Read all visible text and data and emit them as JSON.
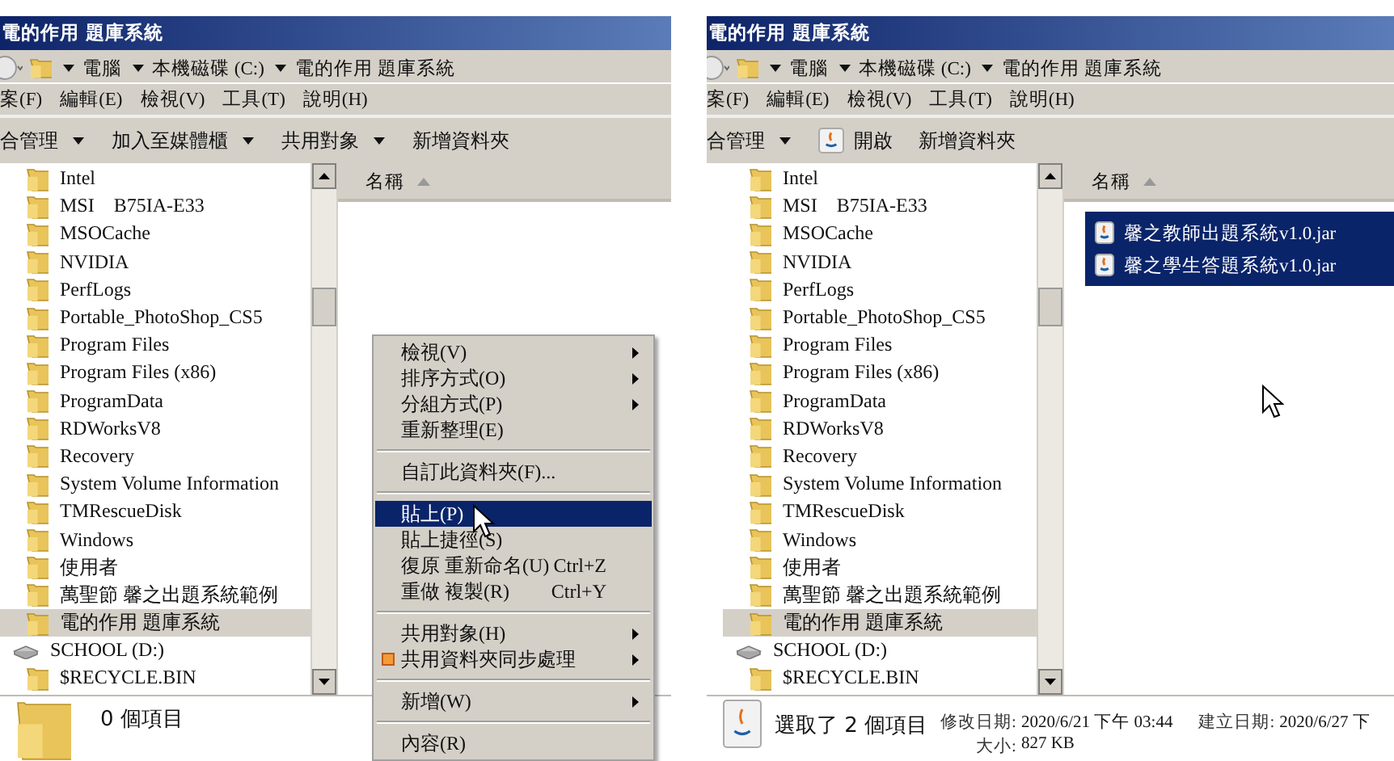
{
  "panels": [
    {
      "title": "電的作用 題庫系統",
      "breadcrumb": [
        "電腦",
        "本機磁碟 (C:)",
        "電的作用 題庫系統"
      ],
      "menu": [
        "案(F)",
        "編輯(E)",
        "檢視(V)",
        "工具(T)",
        "說明(H)"
      ],
      "toolbar": [
        {
          "kind": "dropdown",
          "label": "合管理"
        },
        {
          "kind": "dropdown",
          "label": "加入至媒體櫃"
        },
        {
          "kind": "dropdown",
          "label": "共用對象"
        },
        {
          "kind": "plain",
          "label": "新增資料夾"
        }
      ],
      "tree": [
        {
          "kind": "folder",
          "label": "Intel",
          "selected": false
        },
        {
          "kind": "folder",
          "label": "MSI　B75IA-E33",
          "selected": false
        },
        {
          "kind": "folder",
          "label": "MSOCache",
          "selected": false
        },
        {
          "kind": "folder",
          "label": "NVIDIA",
          "selected": false
        },
        {
          "kind": "folder",
          "label": "PerfLogs",
          "selected": false
        },
        {
          "kind": "folder",
          "label": "Portable_PhotoShop_CS5",
          "selected": false
        },
        {
          "kind": "folder",
          "label": "Program Files",
          "selected": false
        },
        {
          "kind": "folder",
          "label": "Program Files (x86)",
          "selected": false
        },
        {
          "kind": "folder",
          "label": "ProgramData",
          "selected": false
        },
        {
          "kind": "folder",
          "label": "RDWorksV8",
          "selected": false
        },
        {
          "kind": "folder",
          "label": "Recovery",
          "selected": false
        },
        {
          "kind": "folder",
          "label": "System Volume Information",
          "selected": false
        },
        {
          "kind": "folder",
          "label": "TMRescueDisk",
          "selected": false
        },
        {
          "kind": "folder",
          "label": "Windows",
          "selected": false
        },
        {
          "kind": "folder",
          "label": "使用者",
          "selected": false
        },
        {
          "kind": "folder",
          "label": "萬聖節 馨之出題系統範例",
          "selected": false
        },
        {
          "kind": "folder",
          "label": "電的作用 題庫系統",
          "selected": true
        },
        {
          "kind": "drive",
          "label": "SCHOOL (D:)",
          "selected": false
        },
        {
          "kind": "folder",
          "label": "$RECYCLE.BIN",
          "selected": false
        }
      ],
      "column_header": "名稱",
      "context_menu": [
        {
          "kind": "submenu",
          "label": "檢視(V)",
          "selected": false
        },
        {
          "kind": "submenu",
          "label": "排序方式(O)",
          "selected": false
        },
        {
          "kind": "submenu",
          "label": "分組方式(P)",
          "selected": false
        },
        {
          "kind": "item",
          "label": "重新整理(E)",
          "selected": false
        },
        {
          "kind": "separator"
        },
        {
          "kind": "item",
          "label": "自訂此資料夾(F)...",
          "selected": false
        },
        {
          "kind": "separator"
        },
        {
          "kind": "item",
          "label": "貼上(P)",
          "selected": true
        },
        {
          "kind": "item",
          "label": "貼上捷徑(S)",
          "selected": false
        },
        {
          "kind": "item",
          "label": "復原 重新命名(U)",
          "shortcut": "Ctrl+Z",
          "selected": false
        },
        {
          "kind": "item",
          "label": "重做 複製(R)",
          "shortcut": "Ctrl+Y",
          "selected": false
        },
        {
          "kind": "separator"
        },
        {
          "kind": "submenu",
          "label": "共用對象(H)",
          "selected": false
        },
        {
          "kind": "sync-submenu",
          "label": "共用資料夾同步處理",
          "selected": false
        },
        {
          "kind": "separator"
        },
        {
          "kind": "submenu",
          "label": "新增(W)",
          "selected": false
        },
        {
          "kind": "separator"
        },
        {
          "kind": "item",
          "label": "內容(R)",
          "selected": false
        }
      ],
      "status": {
        "kind": "folder",
        "summary": "0 個項目"
      }
    },
    {
      "title": "電的作用 題庫系統",
      "breadcrumb": [
        "電腦",
        "本機磁碟 (C:)",
        "電的作用 題庫系統"
      ],
      "menu": [
        "案(F)",
        "編輯(E)",
        "檢視(V)",
        "工具(T)",
        "說明(H)"
      ],
      "toolbar": [
        {
          "kind": "dropdown",
          "label": "合管理"
        },
        {
          "kind": "open",
          "label": "開啟"
        },
        {
          "kind": "plain",
          "label": "新增資料夾"
        }
      ],
      "tree": [
        {
          "kind": "folder",
          "label": "Intel",
          "selected": false
        },
        {
          "kind": "folder",
          "label": "MSI　B75IA-E33",
          "selected": false
        },
        {
          "kind": "folder",
          "label": "MSOCache",
          "selected": false
        },
        {
          "kind": "folder",
          "label": "NVIDIA",
          "selected": false
        },
        {
          "kind": "folder",
          "label": "PerfLogs",
          "selected": false
        },
        {
          "kind": "folder",
          "label": "Portable_PhotoShop_CS5",
          "selected": false
        },
        {
          "kind": "folder",
          "label": "Program Files",
          "selected": false
        },
        {
          "kind": "folder",
          "label": "Program Files (x86)",
          "selected": false
        },
        {
          "kind": "folder",
          "label": "ProgramData",
          "selected": false
        },
        {
          "kind": "folder",
          "label": "RDWorksV8",
          "selected": false
        },
        {
          "kind": "folder",
          "label": "Recovery",
          "selected": false
        },
        {
          "kind": "folder",
          "label": "System Volume Information",
          "selected": false
        },
        {
          "kind": "folder",
          "label": "TMRescueDisk",
          "selected": false
        },
        {
          "kind": "folder",
          "label": "Windows",
          "selected": false
        },
        {
          "kind": "folder",
          "label": "使用者",
          "selected": false
        },
        {
          "kind": "folder",
          "label": "萬聖節 馨之出題系統範例",
          "selected": false
        },
        {
          "kind": "folder",
          "label": "電的作用 題庫系統",
          "selected": true
        },
        {
          "kind": "drive",
          "label": "SCHOOL (D:)",
          "selected": false
        },
        {
          "kind": "folder",
          "label": "$RECYCLE.BIN",
          "selected": false
        }
      ],
      "column_header": "名稱",
      "files": [
        {
          "label": "馨之教師出題系統v1.0.jar",
          "selected": true
        },
        {
          "label": "馨之學生答題系統v1.0.jar",
          "selected": true
        }
      ],
      "status": {
        "kind": "jar",
        "summary": "選取了 2 個項目",
        "details": [
          {
            "label": "修改日期:",
            "value": "2020/6/21 下午 03:44"
          },
          {
            "label": "大小:",
            "value": "827 KB"
          }
        ],
        "created": {
          "label": "建立日期:",
          "value": "2020/6/27 下"
        }
      }
    }
  ]
}
